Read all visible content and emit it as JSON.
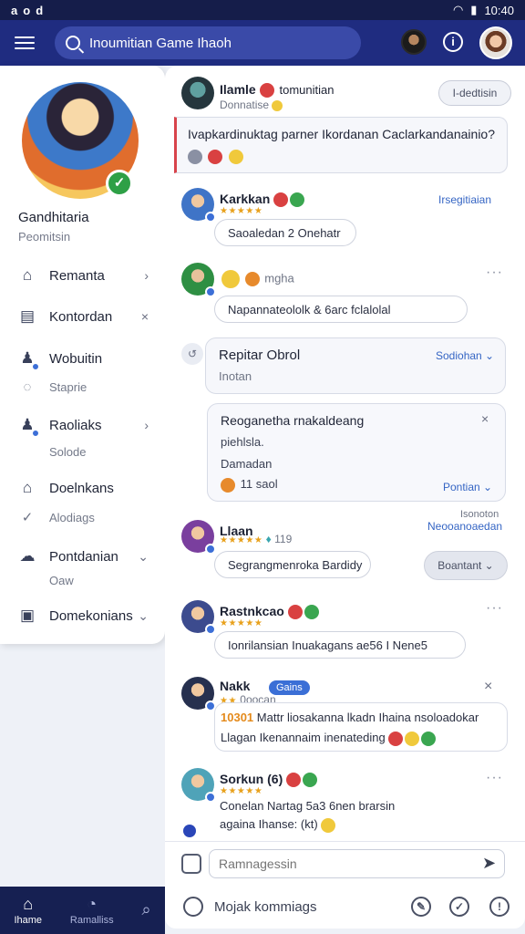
{
  "status_bar": {
    "left_icons": [
      "a",
      "o",
      "d"
    ],
    "time": "10:40"
  },
  "app_bar": {
    "menu_icon": "hamburger-icon",
    "search_value": "Inoumitian Game Ihaoh"
  },
  "drawer": {
    "user_name": "Gandhitaria",
    "user_sub": "Peomitsin",
    "menu": [
      {
        "label": "Remanta",
        "icon": "home-icon",
        "indicator": "›"
      },
      {
        "label": "Kontordan",
        "icon": "calendar-icon",
        "indicator": "×"
      },
      {
        "label": "Wobuitin",
        "icon": "group-icon",
        "indicator": ""
      },
      {
        "label": "Staprie",
        "icon": "chat-icon",
        "indicator": ""
      },
      {
        "label": "Raoliaks",
        "icon": "group-icon",
        "indicator": "›"
      },
      {
        "label": "Solode",
        "icon": "",
        "indicator": ""
      },
      {
        "label": "Doelnkans",
        "icon": "bell-icon",
        "indicator": ""
      },
      {
        "label": "Alodiags",
        "icon": "check-icon",
        "indicator": ""
      },
      {
        "label": "Pontdanian",
        "icon": "cloud-icon",
        "indicator": "⌄"
      },
      {
        "label": "Oaw",
        "icon": "",
        "indicator": ""
      },
      {
        "label": "Domekonians",
        "icon": "clipboard-icon",
        "indicator": "⌄"
      }
    ]
  },
  "bottom_nav": [
    {
      "label": "Ihame",
      "icon": "home-icon"
    },
    {
      "label": "Ramalliss",
      "icon": "clock-icon"
    },
    {
      "label": "",
      "icon": "search-icon"
    }
  ],
  "feed": {
    "pinned": {
      "name": "Ilamle",
      "name2": "tomunitian",
      "sub": "Donnatise",
      "button": "I-dedtisin",
      "question": "Ivapkardinuktag parner Ikordanan Caclarkandanainio?"
    },
    "post1": {
      "name": "Karkkan",
      "stars": "★★★★★",
      "link": "Irsegitiaian",
      "reply": "Saoaledan 2 Onehatr"
    },
    "post2": {
      "meta": "mgha",
      "reply": "Napannateololk & 6arc fclalolal"
    },
    "thread": {
      "title": "Repitar Obrol",
      "sub": "Inotan",
      "link": "Sodiohan ⌄",
      "inner_title": "Reoganetha rnakaldeang",
      "inner_line1": "piehlsla.",
      "inner_line2": "Damadan",
      "inner_count": "11 saol",
      "inner_link": "Pontian ⌄"
    },
    "post3": {
      "name": "Llaan",
      "stars": "★★★★★",
      "count": "119",
      "link1": "Isonoton",
      "link2": "Neooanoaedan",
      "reply": "Segrangmenroka Bardidy",
      "button": "Boantant ⌄"
    },
    "post4": {
      "name": "Rastnkcao",
      "stars": "★★★★★",
      "reply": "Ionrilansian Inuakagans ae56 I Nene5"
    },
    "post5": {
      "name": "Nakk",
      "sub": "0oocan",
      "tag": "Gains",
      "highlight": "10301",
      "line1": "Mattr liosakanna lkadn Ihaina nsoloadokar",
      "line2": "Llagan Ikenannaim inenateding"
    },
    "post6": {
      "name": "Sorkun (6)",
      "stars": "★★★★★",
      "line1": "Conelan Nartag 5a3 6nen brarsin",
      "line2": "againa Ihanse: (kt)"
    }
  },
  "composer": {
    "placeholder": "Ramnagessin",
    "footer_label": "Mojak kommiags"
  }
}
